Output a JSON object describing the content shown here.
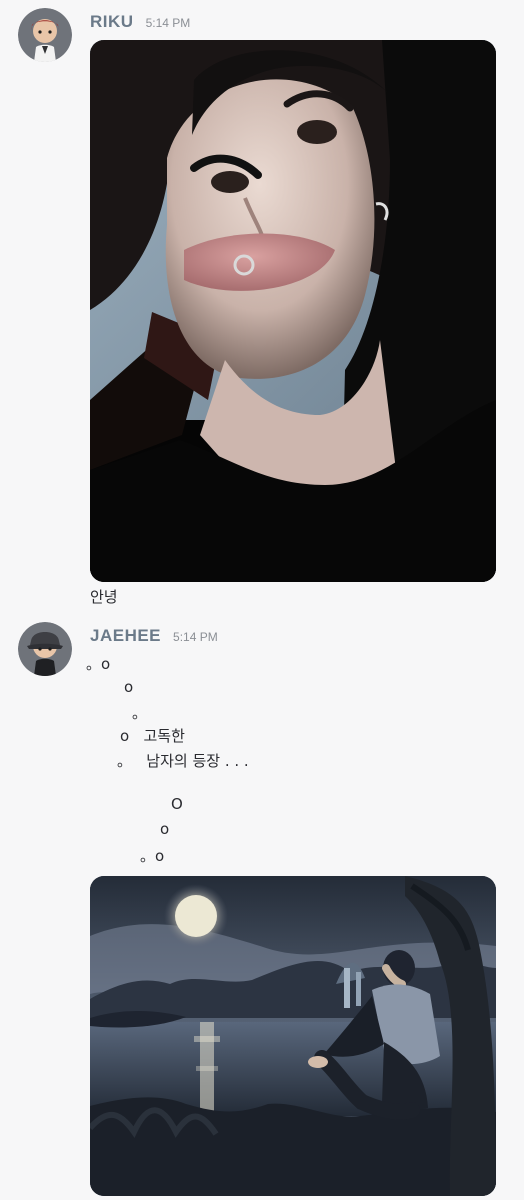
{
  "messages": [
    {
      "username": "RIKU",
      "time": "5:14 PM",
      "text": "안녕"
    },
    {
      "username": "JAEHEE",
      "time": "5:14 PM",
      "lines": [
        "。o",
        "o",
        "。",
        "o   고독한",
        "。   남자의 등장 . . .",
        "O",
        "o",
        "。o"
      ]
    }
  ],
  "colors": {
    "background": "#f7f7f8",
    "username": "#6b7a89",
    "timestamp": "#8b8f95",
    "text": "#2a2b30"
  },
  "icons": [
    "riku-avatar-icon",
    "jaehee-avatar-icon"
  ]
}
